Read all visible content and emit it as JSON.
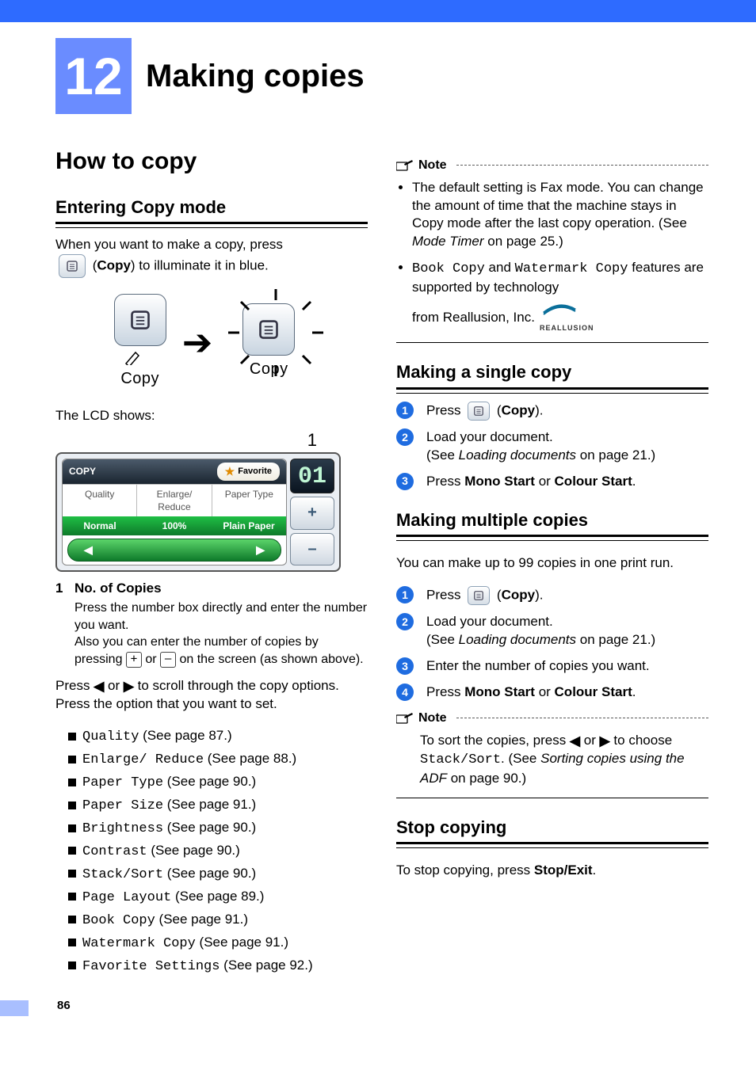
{
  "chapter": {
    "number": "12",
    "title": "Making copies"
  },
  "left": {
    "h1": "How to copy",
    "enter": {
      "h2": "Entering Copy mode",
      "line1a": "When you want to make a copy, press",
      "line1b_pre": "(",
      "line1b_bold": "Copy",
      "line1b_post": ") to illuminate it in blue.",
      "illustration": {
        "btn_label_left": "Copy",
        "btn_label_right": "Copy"
      },
      "lcd_intro": "The LCD shows:",
      "callout_1": "1",
      "lcd": {
        "title": "COPY",
        "favorite": "Favorite",
        "header_cells": [
          "Quality",
          "Enlarge/\nReduce",
          "Paper Type"
        ],
        "value_cells": [
          "Normal",
          "100%",
          "Plain Paper"
        ],
        "num_display": "01",
        "plus": "+",
        "minus": "–",
        "arrow_left": "◀",
        "arrow_right": "▶"
      },
      "def": {
        "num": "1",
        "title": "No. of Copies",
        "body1": "Press the number box directly and enter the number you want.",
        "body2a": "Also you can enter the number of copies by pressing ",
        "body2b": " or ",
        "body2c": " on the screen (as shown above)."
      },
      "scroll_a": "Press ",
      "scroll_left": "◀",
      "scroll_mid": " or ",
      "scroll_right": "▶",
      "scroll_b": " to scroll through the copy options. Press the option that you want to set.",
      "options": [
        {
          "name": "Quality",
          "ref": " (See page 87.)"
        },
        {
          "name": "Enlarge/ Reduce",
          "ref": " (See page 88.)"
        },
        {
          "name": "Paper Type",
          "ref": " (See page 90.)"
        },
        {
          "name": "Paper Size",
          "ref": " (See page 91.)"
        },
        {
          "name": "Brightness",
          "ref": " (See page 90.)"
        },
        {
          "name": "Contrast",
          "ref": " (See page 90.)"
        },
        {
          "name": "Stack/Sort",
          "ref": " (See page 90.)"
        },
        {
          "name": "Page Layout",
          "ref": " (See page 89.)"
        },
        {
          "name": "Book Copy",
          "ref": " (See page 91.)"
        },
        {
          "name": "Watermark Copy",
          "ref": " (See page 91.)"
        },
        {
          "name": "Favorite Settings",
          "ref": " (See page 92.)"
        }
      ]
    }
  },
  "right": {
    "note1": {
      "label": "Note",
      "b1a": "The default setting is Fax mode. You can change the amount of time that the machine stays in Copy mode after the last copy operation. (See ",
      "b1i": "Mode Timer",
      "b1c": " on page 25.)",
      "b2pre": "",
      "b2m1": "Book Copy",
      "b2mid": " and ",
      "b2m2": "Watermark Copy",
      "b2post": " features are supported by technology",
      "b2from": "from Reallusion, Inc.",
      "logo_text": "REALLUSION"
    },
    "single": {
      "h2": "Making a single copy",
      "s1a": "Press ",
      "s1b": " (",
      "s1bold": "Copy",
      "s1c": ").",
      "s2a": "Load your document.",
      "s2b": "(See ",
      "s2i": "Loading documents",
      "s2c": " on page 21.)",
      "s3a": "Press ",
      "s3b1": "Mono Start",
      "s3mid": " or ",
      "s3b2": "Colour Start",
      "s3c": "."
    },
    "multi": {
      "h2": "Making multiple copies",
      "intro": "You can make up to 99 copies in one print run.",
      "s1a": "Press ",
      "s1b": " (",
      "s1bold": "Copy",
      "s1c": ").",
      "s2a": "Load your document.",
      "s2b": "(See ",
      "s2i": "Loading documents",
      "s2c": " on page 21.)",
      "s3": "Enter the number of copies you want.",
      "s4a": "Press ",
      "s4b1": "Mono Start",
      "s4mid": " or ",
      "s4b2": "Colour Start",
      "s4c": "."
    },
    "note2": {
      "label": "Note",
      "a": "To sort the copies, press ",
      "l": "◀",
      "mid1": " or ",
      "r": "▶",
      "b": " to choose ",
      "m": "Stack/Sort",
      "c": ". (See ",
      "i": "Sorting copies using the ADF",
      "d": " on page 90.)"
    },
    "stop": {
      "h2": "Stop copying",
      "a": "To stop copying, press ",
      "b": "Stop/Exit",
      "c": "."
    }
  },
  "pageNumber": "86"
}
